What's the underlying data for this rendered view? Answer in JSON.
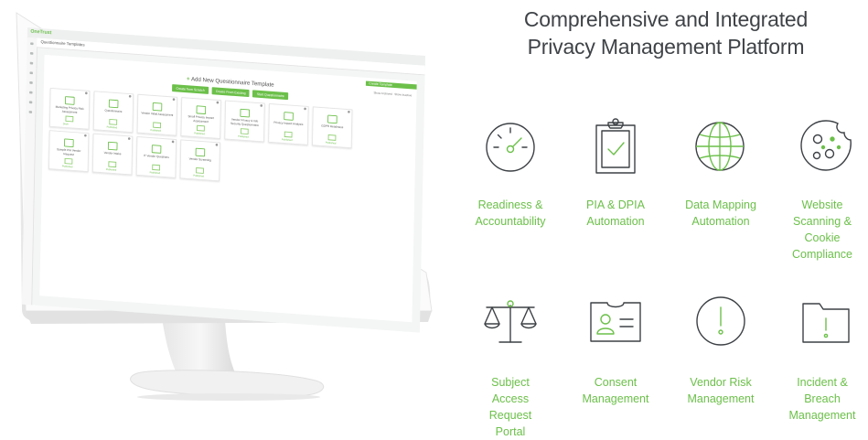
{
  "headline": {
    "line1": "Comprehensive and Integrated",
    "line2": "Privacy Management Platform"
  },
  "colors": {
    "accent": "#6cc04a",
    "icon_stroke": "#3d4145",
    "headline_text": "#3f4347"
  },
  "features": [
    {
      "icon": "gauge-icon",
      "lines": [
        "Readiness &",
        "Accountability"
      ]
    },
    {
      "icon": "clipboard-check-icon",
      "lines": [
        "PIA & DPIA",
        "Automation"
      ]
    },
    {
      "icon": "globe-icon",
      "lines": [
        "Data Mapping",
        "Automation"
      ]
    },
    {
      "icon": "cookie-icon",
      "lines": [
        "Website",
        "Scanning &",
        "Cookie",
        "Compliance"
      ]
    },
    {
      "icon": "scales-icon",
      "lines": [
        "Subject",
        "Access",
        "Request",
        "Portal"
      ]
    },
    {
      "icon": "id-card-icon",
      "lines": [
        "Consent",
        "Management"
      ]
    },
    {
      "icon": "alert-circle-icon",
      "lines": [
        "Vendor Risk",
        "Management"
      ]
    },
    {
      "icon": "alert-folder-icon",
      "lines": [
        "Incident &",
        "Breach",
        "Management"
      ]
    }
  ],
  "screen": {
    "logo": "OneTrust",
    "page_title": "Questionnaire Templates",
    "heading_prefix": "+",
    "heading": "Add New Questionnaire Template",
    "strip_text": "Create Template",
    "buttons": [
      "Create from Scratch",
      "Create From Existing",
      "Start Questionnaire"
    ],
    "links": [
      "Show Archived",
      "Show Inactive"
    ],
    "cards": [
      {
        "title": "Marketing Privacy Risk Assessment",
        "status": "Draft"
      },
      {
        "title": "Questionnaire",
        "status": "Published"
      },
      {
        "title": "Vendor Initial Assessment",
        "status": "Published"
      },
      {
        "title": "Small Privacy Impact Assessment",
        "status": "Published"
      },
      {
        "title": "Vendor Privacy & Info Security Questionnaire",
        "status": "Published"
      },
      {
        "title": "Privacy Impact Analysis",
        "status": "Published"
      },
      {
        "title": "GDPR Readiness",
        "status": "Published"
      },
      {
        "title": "Sample PIA Vendor Request",
        "status": "Published"
      },
      {
        "title": "Vendor Intake",
        "status": "Published"
      },
      {
        "title": "IT Vendor Questions",
        "status": "Published"
      },
      {
        "title": "Vendor Screening",
        "status": "Published"
      }
    ]
  }
}
